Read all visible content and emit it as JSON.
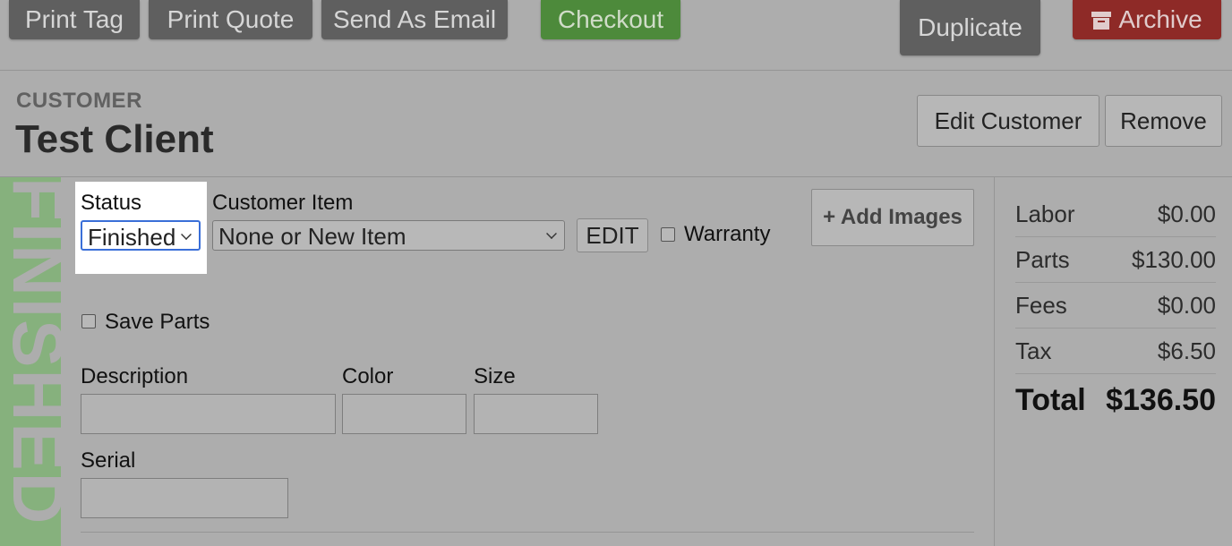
{
  "toolbar": {
    "print_tag": "Print Tag",
    "print_quote": "Print Quote",
    "send_email": "Send As Email",
    "checkout": "Checkout",
    "duplicate": "Duplicate",
    "archive": "Archive"
  },
  "customer": {
    "section_label": "CUSTOMER",
    "name": "Test Client",
    "edit_button": "Edit Customer",
    "remove_button": "Remove"
  },
  "ticket": {
    "stamp": "FINISHED",
    "status_label": "Status",
    "status_value": "Finished",
    "customer_item_label": "Customer Item",
    "customer_item_value": "None or New Item",
    "edit_button": "EDIT",
    "warranty_label": "Warranty",
    "warranty_checked": false,
    "add_images_button": "+ Add Images",
    "save_parts_label": "Save Parts",
    "save_parts_checked": false,
    "description_label": "Description",
    "description_value": "",
    "color_label": "Color",
    "color_value": "",
    "size_label": "Size",
    "size_value": "",
    "serial_label": "Serial",
    "serial_value": ""
  },
  "summary": {
    "labor_label": "Labor",
    "labor_value": "$0.00",
    "parts_label": "Parts",
    "parts_value": "$130.00",
    "fees_label": "Fees",
    "fees_value": "$0.00",
    "tax_label": "Tax",
    "tax_value": "$6.50",
    "total_label": "Total",
    "total_value": "$136.50"
  },
  "colors": {
    "checkout": "#4d8a3b",
    "archive": "#8e2a27",
    "stamp": "#86b17d",
    "focus": "#3a6fd8"
  }
}
